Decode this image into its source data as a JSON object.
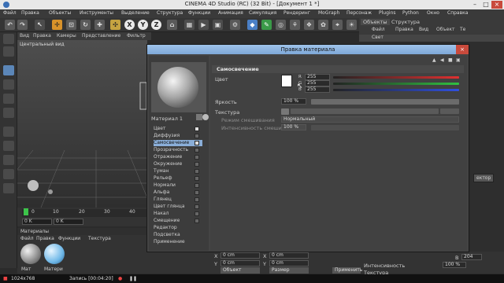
{
  "window": {
    "title": "CINEMA 4D Studio (RC) (32 Bit) - [Документ 1 *]"
  },
  "menubar": [
    "Файл",
    "Правка",
    "Объекты",
    "Инструменты",
    "Выделение",
    "Структура",
    "Функции",
    "Анимация",
    "Симуляция",
    "Рендеринг",
    "MoGraph",
    "Персонаж",
    "Plugins",
    "Python",
    "Окно",
    "Справка"
  ],
  "toolbar": {
    "x": "X",
    "y": "Y",
    "z": "Z"
  },
  "viewport": {
    "menu": [
      "Вид",
      "Правка",
      "Камеры",
      "Представление",
      "Фильтр",
      "Индикация",
      "Панели"
    ],
    "label": "Центральный вид"
  },
  "timeline": {
    "ticks": [
      "0",
      "10",
      "20",
      "30",
      "40"
    ],
    "frame_start": "0 K",
    "frame_end": "0 K"
  },
  "materials_panel": {
    "title": "Материалы",
    "menu": [
      "Файл",
      "Правка",
      "Функции",
      "Текстура"
    ],
    "items": [
      "Мат",
      "Матери"
    ]
  },
  "objects_panel": {
    "tabs": [
      "Объекты",
      "Структура"
    ],
    "menu": [
      "Файл",
      "Правка",
      "Вид",
      "Объект",
      "Те"
    ],
    "row": "Свет"
  },
  "right_panel": {
    "field": "ектор"
  },
  "attributes": {
    "x_value": "0 cm",
    "y_value": "0 cm",
    "x2": "0 cm",
    "y2": "0 cm",
    "mode1": "Объект",
    "mode2": "Размер",
    "apply": "Применить",
    "intensity_label": "Интенсивность",
    "intensity_value": "100 %",
    "b_value": "204",
    "texture_label": "Текстура"
  },
  "dialog": {
    "title": "Правка материала",
    "material_name": "Материал 1",
    "channels": [
      {
        "label": "Цвет",
        "checked": true
      },
      {
        "label": "Диффузия",
        "checked": false
      },
      {
        "label": "Самосвечение",
        "checked": true,
        "selected": true
      },
      {
        "label": "Прозрачность",
        "checked": false
      },
      {
        "label": "Отражение",
        "checked": false
      },
      {
        "label": "Окружение",
        "checked": false
      },
      {
        "label": "Туман",
        "checked": false
      },
      {
        "label": "Рельеф",
        "checked": false
      },
      {
        "label": "Нормали",
        "checked": false
      },
      {
        "label": "Альфа",
        "checked": false
      },
      {
        "label": "Глянец",
        "checked": false
      },
      {
        "label": "Цвет глянца",
        "checked": false
      },
      {
        "label": "Накал",
        "checked": false
      },
      {
        "label": "Смещение",
        "checked": false
      },
      {
        "label": "Редактор",
        "checked": null
      },
      {
        "label": "Подсветка",
        "checked": null
      },
      {
        "label": "Применение",
        "checked": null
      }
    ],
    "section": "Самосвечение",
    "color_label": "Цвет",
    "r_label": "R",
    "g_label": "G",
    "b_label": "B",
    "r_value": "255",
    "g_value": "255",
    "b_value": "255",
    "brightness_label": "Яркость",
    "brightness_value": "100 %",
    "texture_label": "Текстура",
    "mix_mode_label": "Режим смешивания",
    "mix_mode_value": "Нормальный",
    "mix_strength_label": "Интенсивность смешивания",
    "mix_strength_value": "100 %"
  },
  "statusbar": {
    "resolution": "1024x768",
    "recording": "Запись [00:04:20]"
  },
  "colors": {
    "accent": "#7ea8d8",
    "timeline_cursor": "#3dc44a",
    "close": "#c94a3c"
  }
}
